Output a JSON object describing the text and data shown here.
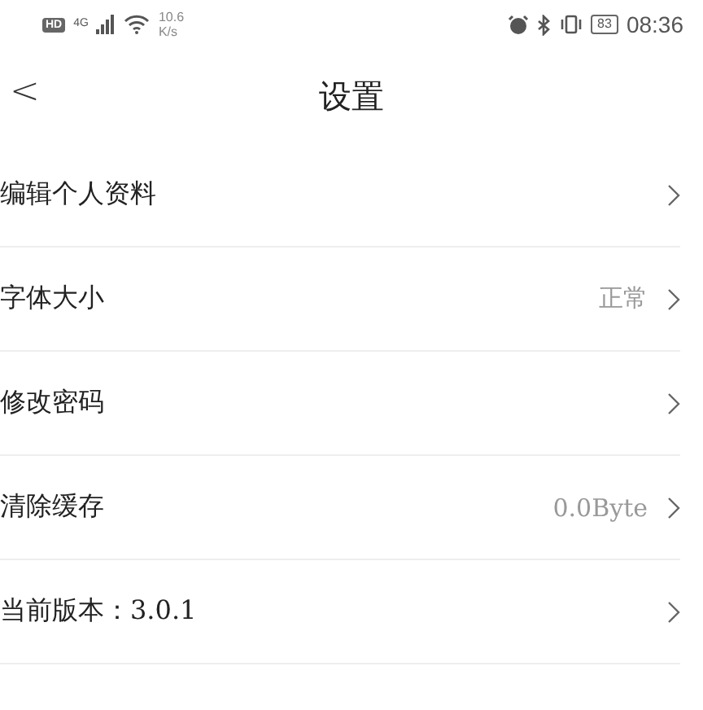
{
  "status_bar": {
    "hd": "HD",
    "network": "4G",
    "speed": "10.6",
    "speed_unit": "K/s",
    "battery": "83",
    "time": "08:36"
  },
  "header": {
    "back": "<",
    "title": "设置"
  },
  "items": [
    {
      "label": "编辑个人资料"
    },
    {
      "label": "字体大小",
      "value": "正常"
    },
    {
      "label": "修改密码"
    },
    {
      "label": "清除缓存",
      "value": "0.0Byte"
    },
    {
      "label": "当前版本：3.0.1"
    }
  ]
}
